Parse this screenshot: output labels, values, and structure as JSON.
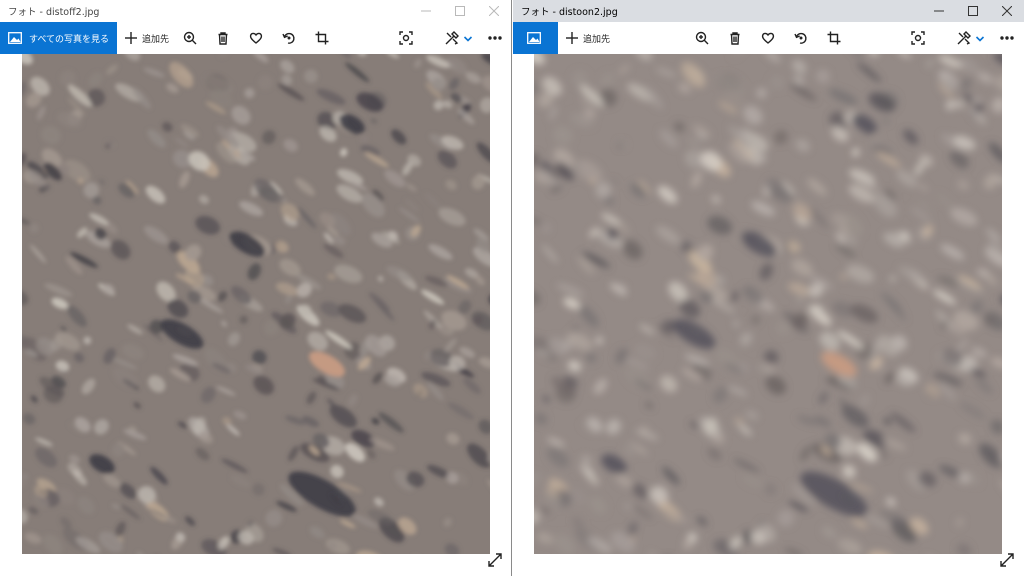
{
  "windows": [
    {
      "title": "フォト - distoff2.jpg",
      "all_photos_label": "すべての写真を見る",
      "add_to_label": "追加先"
    },
    {
      "title": "フォト - distoon2.jpg",
      "all_photos_label": "",
      "add_to_label": "追加先"
    }
  ],
  "colors": {
    "accent": "#0a74d3",
    "active_titlebar": "#dadde2",
    "photo_base": "#8b817b"
  },
  "icons": [
    "photos-app-icon",
    "plus-icon",
    "zoom-in-icon",
    "delete-icon",
    "heart-icon",
    "rotate-icon",
    "crop-icon",
    "enhance-icon",
    "edit-icon",
    "chevron-down-icon",
    "more-icon",
    "expand-icon"
  ]
}
